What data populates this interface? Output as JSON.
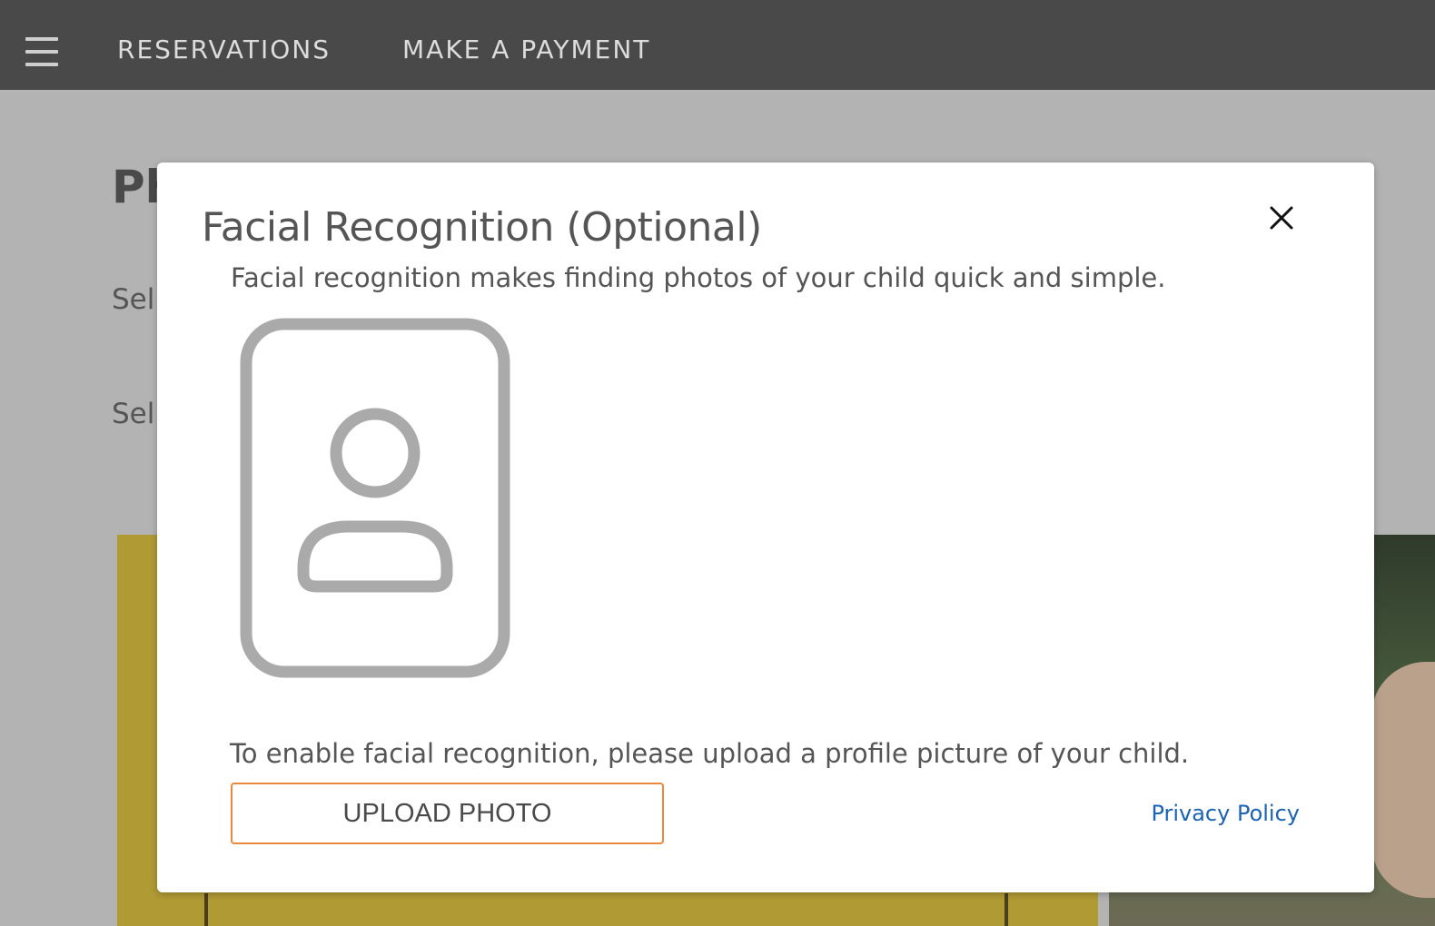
{
  "nav": {
    "links": [
      "RESERVATIONS",
      "MAKE A PAYMENT"
    ]
  },
  "background": {
    "title_fragment": "Ph",
    "select_fragment_1": "Sel",
    "select_fragment_2": "Sel"
  },
  "modal": {
    "title": "Facial Recognition (Optional)",
    "description": "Facial recognition makes finding photos of your child quick and simple.",
    "instruction": "To enable facial recognition, please upload a profile picture of your child.",
    "upload_button": "UPLOAD PHOTO",
    "privacy_link": "Privacy Policy",
    "close_icon": "close-icon",
    "placeholder_icon": "profile-placeholder-icon"
  },
  "colors": {
    "topbar": "#494949",
    "overlay": "#b3b3b3",
    "upload_border": "#e8883a",
    "link": "#1a63b5"
  }
}
